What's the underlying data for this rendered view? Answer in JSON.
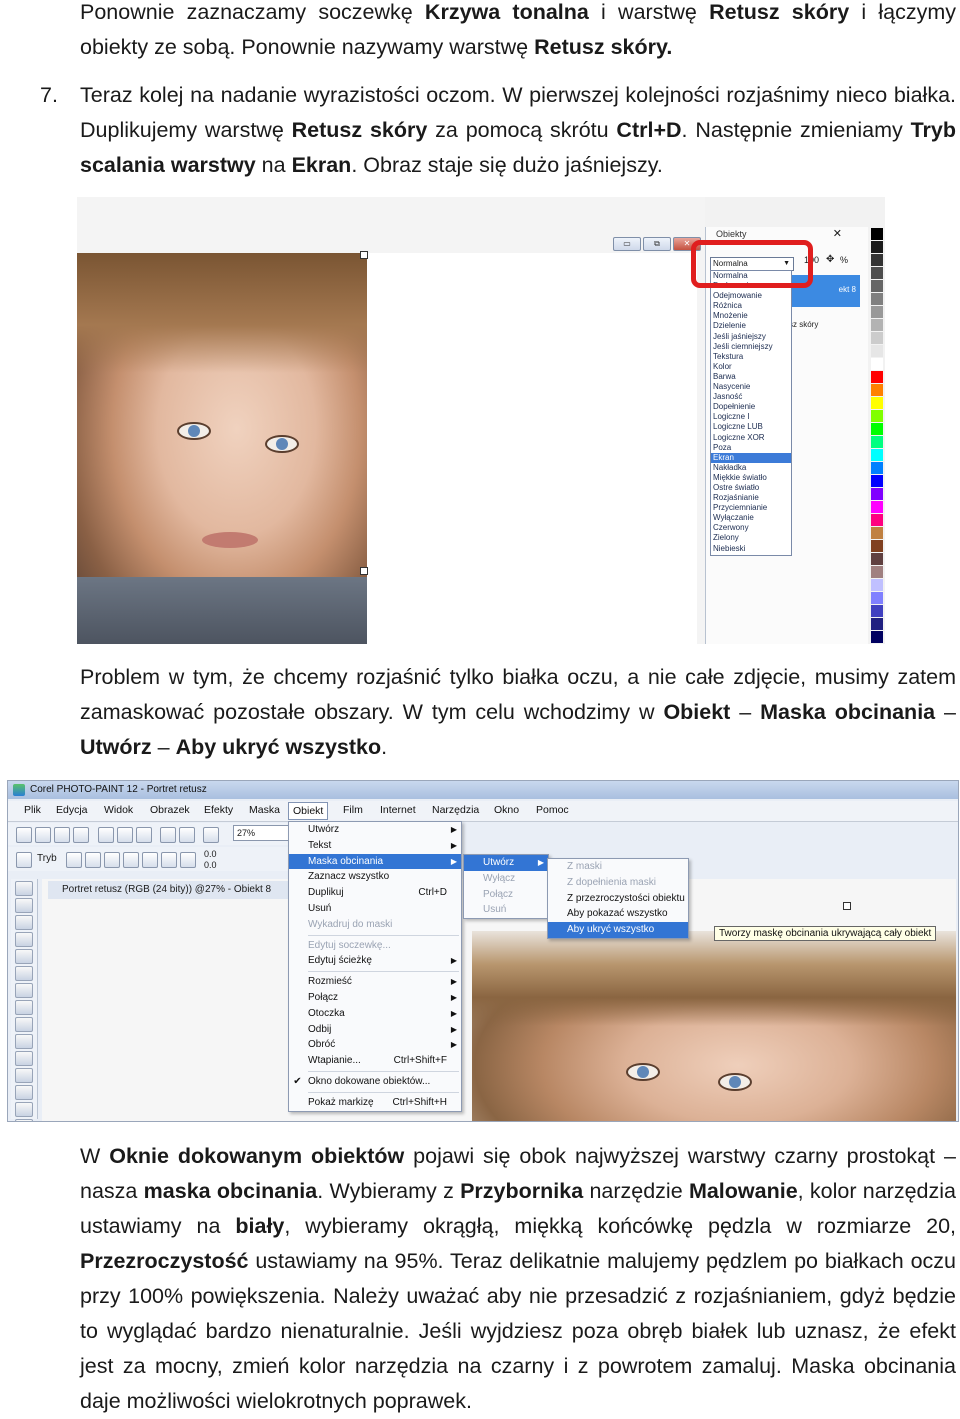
{
  "intro": {
    "p1_a": "Ponownie zaznaczamy soczewkę ",
    "p1_b": "Krzywa tonalna",
    "p1_c": " i warstwę ",
    "p1_d": "Retusz skóry",
    "p1_e": " i łączymy obiekty ze sobą. Ponownie nazywamy warstwę ",
    "p1_f": "Retusz skóry."
  },
  "step7": {
    "number": "7.",
    "a": "Teraz kolej na nadanie wyrazistości oczom. W pierwszej kolejności rozjaśnimy nieco białka. Duplikujemy warstwę ",
    "b": "Retusz skóry",
    "c": " za pomocą skrótu ",
    "d": "Ctrl+D",
    "e": ". Następnie zmieniamy ",
    "f": "Tryb scalania warstwy",
    "g": " na ",
    "h": "Ekran",
    "i": ". Obraz staje się dużo jaśniejszy."
  },
  "shot1": {
    "window_buttons": [
      "▭",
      "⧉",
      "✕"
    ],
    "docker_title": "Obiekty",
    "blend_selected": "Normalna",
    "opacity": "100",
    "opacity_unit": "%",
    "layer_highlight": "ekt 8",
    "layer_label": "sz skóry",
    "blend_modes": [
      "Normalna",
      "Dodawanie",
      "Odejmowanie",
      "Różnica",
      "Mnożenie",
      "Dzielenie",
      "Jeśli jaśniejszy",
      "Jeśli ciemniejszy",
      "Tekstura",
      "Kolor",
      "Barwa",
      "Nasycenie",
      "Jasność",
      "Dopełnienie",
      "Logiczne I",
      "Logiczne LUB",
      "Logiczne XOR",
      "Poza",
      "Ekran",
      "Nakładka",
      "Miękkie światło",
      "Ostre światło",
      "Rozjaśnianie",
      "Przyciemnianie",
      "Wyłączanie",
      "Czerwony",
      "Zielony",
      "Niebieski"
    ],
    "selected_mode": "Ekran",
    "palette": [
      "#000000",
      "#1a1a1a",
      "#333333",
      "#4d4d4d",
      "#666666",
      "#808080",
      "#999999",
      "#b3b3b3",
      "#cccccc",
      "#e6e6e6",
      "#ffffff",
      "#ff0000",
      "#ff8000",
      "#ffff00",
      "#80ff00",
      "#00ff00",
      "#00ff80",
      "#00ffff",
      "#0080ff",
      "#0000ff",
      "#8000ff",
      "#ff00ff",
      "#ff0080",
      "#c08040",
      "#804020",
      "#604040",
      "#a08080",
      "#c0c0ff",
      "#8080ff",
      "#4040c0",
      "#202080",
      "#000060"
    ]
  },
  "p2": {
    "a": "Problem w tym, że chcemy rozjaśnić tylko białka oczu, a nie całe zdjęcie, musimy zatem zamaskować pozostałe obszary. W tym celu wchodzimy w ",
    "b": "Obiekt",
    "c": " – ",
    "d": "Maska obcinania",
    "e": " – ",
    "f": "Utwórz",
    "g": " – ",
    "h": "Aby ukryć wszystko",
    "i": "."
  },
  "shot2": {
    "title": "Corel PHOTO-PAINT 12 - Portret retusz",
    "menus": [
      "Plik",
      "Edycja",
      "Widok",
      "Obrazek",
      "Efekty",
      "Maska",
      "Obiekt",
      "Film",
      "Internet",
      "Narzędzia",
      "Okno",
      "Pomoc"
    ],
    "active_menu": "Obiekt",
    "zoom": "27%",
    "mode_label": "Tryb",
    "coord_x": "0.0",
    "coord_y": "0.0",
    "doc_title": "Portret retusz (RGB (24 bity)) @27% - Obiekt 8",
    "object_menu": [
      {
        "label": "Utwórz",
        "arrow": true
      },
      {
        "label": "Tekst",
        "arrow": true
      },
      {
        "label": "Maska obcinania",
        "arrow": true,
        "hl": true
      },
      {
        "label": "Zaznacz wszystko"
      },
      {
        "label": "Duplikuj",
        "shortcut": "Ctrl+D"
      },
      {
        "label": "Usuń"
      },
      {
        "label": "Wykadruj do maski",
        "dis": true
      },
      {
        "sep": true
      },
      {
        "label": "Edytuj soczewkę...",
        "dis": true
      },
      {
        "label": "Edytuj ścieżkę",
        "arrow": true
      },
      {
        "sep": true
      },
      {
        "label": "Rozmieść",
        "arrow": true
      },
      {
        "label": "Połącz",
        "arrow": true
      },
      {
        "label": "Otoczka",
        "arrow": true
      },
      {
        "label": "Odbij",
        "arrow": true
      },
      {
        "label": "Obróć",
        "arrow": true
      },
      {
        "label": "Wtapianie...",
        "shortcut": "Ctrl+Shift+F"
      },
      {
        "sep": true
      },
      {
        "label": "Okno dokowane obiektów...",
        "check": true
      },
      {
        "sep": true
      },
      {
        "label": "Pokaż markizę",
        "shortcut": "Ctrl+Shift+H"
      }
    ],
    "mask_menu": [
      {
        "label": "Utwórz",
        "arrow": true,
        "hl": true
      },
      {
        "label": "Wyłącz",
        "dis": true
      },
      {
        "label": "Połącz",
        "dis": true
      },
      {
        "label": "Usuń",
        "dis": true
      }
    ],
    "create_menu": [
      {
        "label": "Z maski",
        "dis": true
      },
      {
        "label": "Z dopełnienia maski",
        "dis": true
      },
      {
        "label": "Z przezroczystości obiektu"
      },
      {
        "label": "Aby pokazać wszystko"
      },
      {
        "label": "Aby ukryć wszystko",
        "hl": true
      }
    ],
    "tooltip": "Tworzy maskę obcinania ukrywającą cały obiekt"
  },
  "p3": {
    "a": "W ",
    "b": "Oknie dokowanym obiektów",
    "c": " pojawi się obok najwyższej warstwy czarny prostokąt – nasza ",
    "d": "maska obcinania",
    "e": ". Wybieramy z ",
    "f": "Przybornika",
    "g": " narzędzie ",
    "h": "Malowanie",
    "i": ", kolor narzędzia ustawiamy na ",
    "j": "biały",
    "k": ", wybieramy okrągłą, miękką końcówkę pędzla w rozmiarze 20, ",
    "l": "Przezroczystość",
    "m": " ustawiamy na 95%. Teraz delikatnie malujemy pędzlem po białkach oczu przy 100% powiększenia. Należy uważać aby nie przesadzić z rozjaśnianiem, gdyż będzie to wyglądać bardzo nienaturalnie. Jeśli wyjdziesz poza obręb białek lub uznasz, że efekt jest za mocny, zmień kolor narzędzia na czarny i z powrotem zamaluj. Maska obcinania daje możliwości wielokrotnych poprawek."
  }
}
